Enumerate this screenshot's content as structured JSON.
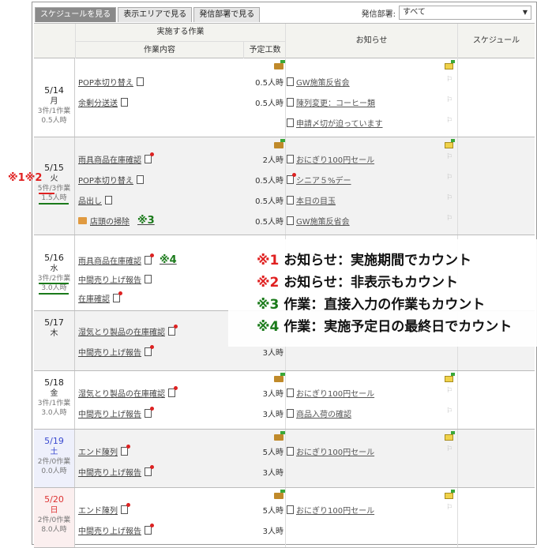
{
  "tabs": [
    {
      "label": "スケジュールを見る",
      "active": true
    },
    {
      "label": "表示エリアで見る",
      "active": false
    },
    {
      "label": "発信部署で見る",
      "active": false
    }
  ],
  "dept_filter": {
    "label": "発信部署:",
    "value": "すべて"
  },
  "header": {
    "work": "実施する作業",
    "work_content": "作業内容",
    "planned_hours": "予定工数",
    "notices": "お知らせ",
    "schedule": "スケジュール"
  },
  "days": [
    {
      "date": "5/14",
      "dow": "月",
      "count": "3件/1作業",
      "hours": "0.5人時",
      "style": "normal",
      "tasks": [
        {
          "label": "POP本切り替え",
          "amount": "0.5人時"
        },
        {
          "label": "余剰分送送",
          "amount": "0.5人時"
        }
      ],
      "notices": [
        "GW施策反省会",
        "陳列変更：コーヒー類",
        "申請〆切が迫っています"
      ]
    },
    {
      "date": "5/15",
      "dow": "火",
      "count": "5件/3作業",
      "hours": "1.5人時",
      "style": "normal",
      "tasks": [
        {
          "label": "雨具商品在庫確認",
          "amount": "2人時"
        },
        {
          "label": "POP本切り替え",
          "amount": "0.5人時"
        },
        {
          "label": "品出し",
          "amount": "0.5人時"
        },
        {
          "label": "店頭の掃除",
          "amount": "0.5人時"
        }
      ],
      "notices": [
        "おにぎり100円セール",
        "シニア５%デー",
        "本日の目玉",
        "GW施策反省会"
      ]
    },
    {
      "date": "5/16",
      "dow": "水",
      "count": "3件/2作業",
      "hours": "3.0人時",
      "style": "normal",
      "tasks": [
        {
          "label": "雨具商品在庫確認",
          "amount": ""
        },
        {
          "label": "中間売り上げ報告",
          "amount": ""
        },
        {
          "label": "在庫確認",
          "amount": ""
        }
      ],
      "notices": []
    },
    {
      "date": "5/17",
      "dow": "木",
      "count": "",
      "hours": "",
      "style": "normal",
      "tasks": [
        {
          "label": "湿気とり製品の在庫確認",
          "amount": ""
        },
        {
          "label": "中間売り上げ報告",
          "amount": "3人時"
        }
      ],
      "notices": []
    },
    {
      "date": "5/18",
      "dow": "金",
      "count": "3件/1作業",
      "hours": "3.0人時",
      "style": "normal",
      "tasks": [
        {
          "label": "湿気とり製品の在庫確認",
          "amount": "3人時"
        },
        {
          "label": "中間売り上げ報告",
          "amount": "3人時"
        }
      ],
      "notices": [
        "おにぎり100円セール",
        "商品入荷の確認"
      ]
    },
    {
      "date": "5/19",
      "dow": "土",
      "count": "2件/0作業",
      "hours": "0.0人時",
      "style": "sat",
      "tasks": [
        {
          "label": "エンド陳列",
          "amount": "5人時"
        },
        {
          "label": "中間売り上げ報告",
          "amount": "3人時"
        }
      ],
      "notices": [
        "おにぎり100円セール"
      ]
    },
    {
      "date": "5/20",
      "dow": "日",
      "count": "2件/0作業",
      "hours": "8.0人時",
      "style": "sun",
      "tasks": [
        {
          "label": "エンド陳列",
          "amount": "5人時"
        },
        {
          "label": "中間売り上げ報告",
          "amount": "3人時"
        }
      ],
      "notices": [
        "おにぎり100円セール"
      ]
    }
  ],
  "markers": {
    "m1": "※1",
    "m2": "※2",
    "m3": "※3",
    "m4": "※4"
  },
  "annotations": [
    {
      "mark": "※1",
      "text": "お知らせ：実施期間でカウント",
      "color": "#e02020"
    },
    {
      "mark": "※2",
      "text": "お知らせ：非表示もカウント",
      "color": "#e02020"
    },
    {
      "mark": "※3",
      "text": "作業：直接入力の作業もカウント",
      "color": "#1a7a1a"
    },
    {
      "mark": "※4",
      "text": "作業：実施予定日の最終日でカウント",
      "color": "#1a7a1a"
    }
  ]
}
